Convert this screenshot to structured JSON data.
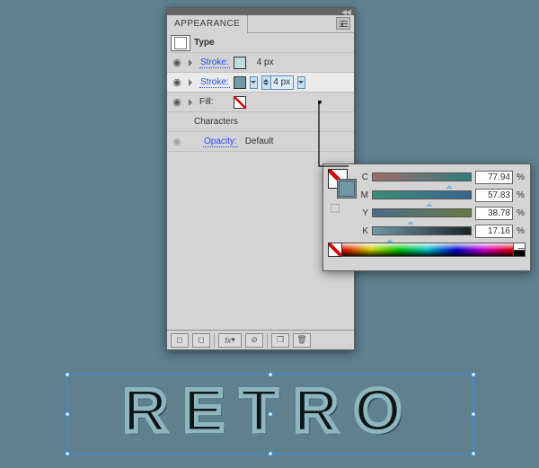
{
  "panel_title": "APPEARANCE",
  "rows": {
    "type": "Type",
    "stroke1": {
      "label": "Stroke:",
      "value": "4 px",
      "swatch": "#bedede"
    },
    "stroke2": {
      "label": "Stroke:",
      "value": "4 px",
      "swatch": "#6f99a5"
    },
    "fill": {
      "label": "Fill:"
    },
    "characters": "Characters",
    "opacity": {
      "label": "Opacity:",
      "value": "Default"
    }
  },
  "bottom_btns": {
    "fx": "fx"
  },
  "cmyk": {
    "labels": {
      "c": "C",
      "m": "M",
      "y": "Y",
      "k": "K"
    },
    "c": {
      "value": "77.94",
      "pct": 77.94,
      "grad": "linear-gradient(to right,#a16b6b,#2f7d7d)"
    },
    "m": {
      "value": "57.83",
      "pct": 57.83,
      "grad": "linear-gradient(to right,#3b8d78,#3b648d)"
    },
    "y": {
      "value": "38.78",
      "pct": 38.78,
      "grad": "linear-gradient(to right,#4b6c8a,#6a7a45)"
    },
    "k": {
      "value": "17.16",
      "pct": 17.16,
      "grad": "linear-gradient(to right,#6f99a5,#1b232a)"
    },
    "unit": "%",
    "swatch": "#6f99a5"
  },
  "artwork_text": "RETRO"
}
